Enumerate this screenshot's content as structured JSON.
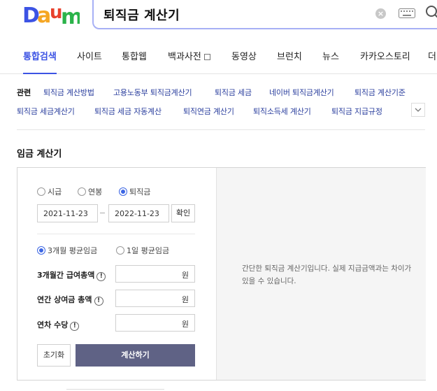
{
  "header": {
    "search_query": "퇴직금 계산기",
    "clear_glyph": "×"
  },
  "brand": {
    "accent": "#3c53e4"
  },
  "tabs": [
    {
      "label": "통합검색",
      "active": true
    },
    {
      "label": "사이트"
    },
    {
      "label": "통합웹"
    },
    {
      "label": "백과사전"
    },
    {
      "label": "동영상"
    },
    {
      "label": "브런치"
    },
    {
      "label": "뉴스"
    },
    {
      "label": "카카오스토리"
    },
    {
      "label": "더"
    }
  ],
  "related": {
    "label": "관련",
    "row1": [
      "퇴직금 계산방법",
      "고용노동부 퇴직금계산기",
      "퇴직금 세금",
      "네이버 퇴직금계산기",
      "퇴직금 계산기준"
    ],
    "row2": [
      "퇴직금 세금계산기",
      "퇴직금 세금 자동계산",
      "퇴직연금 계산기",
      "퇴직소득세 계산기",
      "퇴직금 지급규정"
    ]
  },
  "calculator": {
    "title": "임금 계산기",
    "type_options": [
      "시급",
      "연봉",
      "퇴직금"
    ],
    "type_selected": "퇴직금",
    "start_date": "2021-11-23",
    "end_date": "2022-11-23",
    "confirm_label": "확인",
    "wage_options": [
      "3개월 평균임금",
      "1일 평균임금"
    ],
    "wage_selected": "3개월 평균임금",
    "fields": [
      {
        "label": "3개월간 급여총액",
        "unit": "원"
      },
      {
        "label": "연간 상여금 총액",
        "unit": "원"
      },
      {
        "label": "연차 수당",
        "unit": "원"
      }
    ],
    "info_glyph": "!",
    "reset_label": "초기화",
    "calc_label": "계산하기",
    "description": "간단한 퇴직금 계산기입니다. 실제 지급금액과는 차이가 있을 수 있습니다."
  }
}
